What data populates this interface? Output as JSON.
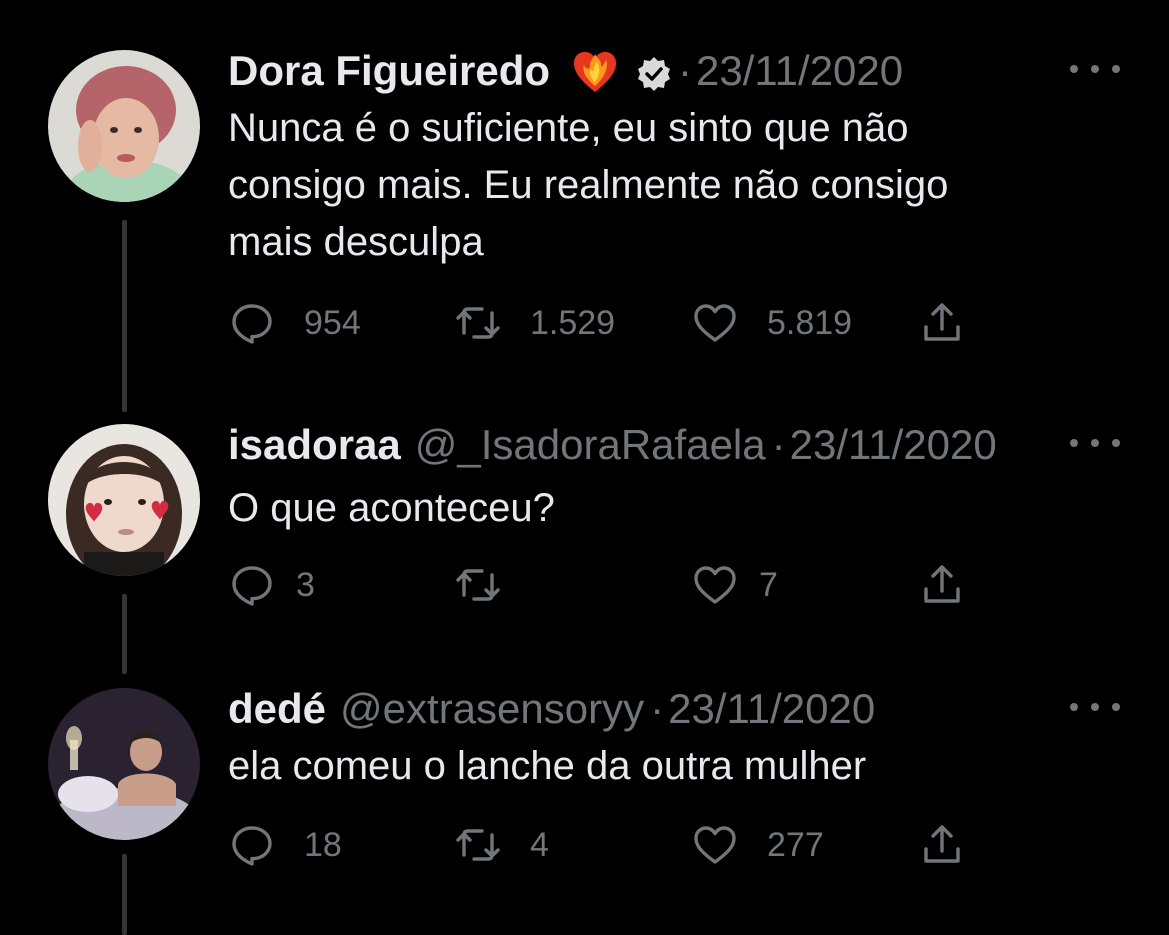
{
  "colors": {
    "background": "#000000",
    "text": "#e7e9ea",
    "secondary": "#71767b",
    "thread_line": "#333639"
  },
  "tweets": [
    {
      "name": "Dora Figueiredo",
      "handle": "",
      "date": "23/11/2020",
      "badges": [
        "heart-on-fire-emoji",
        "verified-badge-icon"
      ],
      "text_lines": [
        "Nunca é o suficiente, eu sinto que não",
        "consigo mais. Eu realmente não consigo",
        "mais desculpa"
      ],
      "replies": "954",
      "retweets": "1.529",
      "likes": "5.819"
    },
    {
      "name": "isadoraa",
      "handle": "@_IsadoraRafaela",
      "date": "23/11/2020",
      "text_lines": [
        "O que aconteceu?"
      ],
      "replies": "3",
      "retweets": "",
      "likes": "7"
    },
    {
      "name": "dedé",
      "handle": "@extrasensoryy",
      "date": "23/11/2020",
      "text_lines": [
        "ela comeu o lanche da outra mulher"
      ],
      "replies": "18",
      "retweets": "4",
      "likes": "277"
    }
  ],
  "separator": "·",
  "icons": {
    "reply": "reply-icon",
    "retweet": "retweet-icon",
    "like": "like-icon",
    "share": "share-icon",
    "more": "more-options-icon"
  }
}
